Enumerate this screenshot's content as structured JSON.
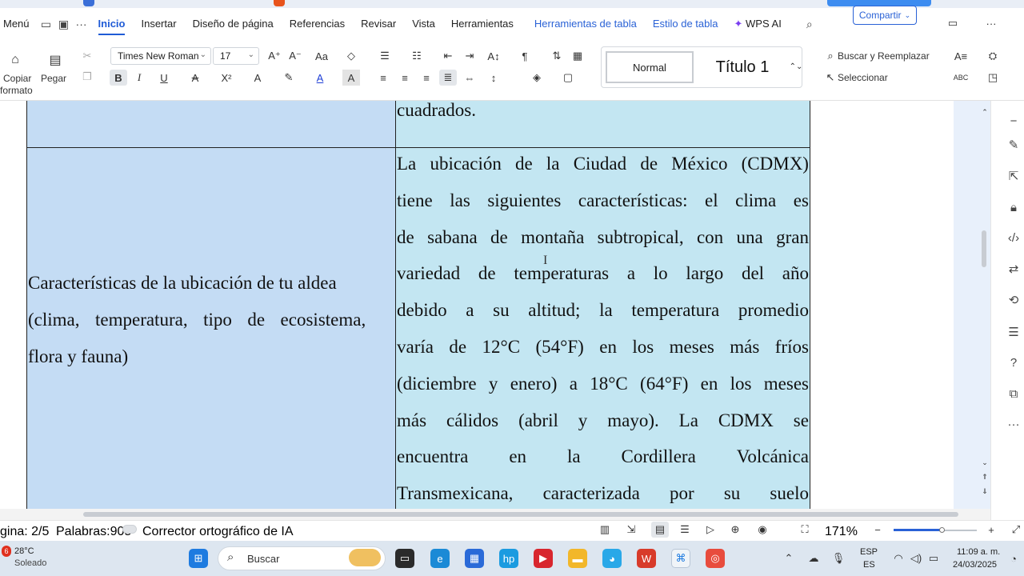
{
  "menubar": {
    "menu_label": "Menú",
    "tabs": [
      {
        "label": "Inicio",
        "active": true
      },
      {
        "label": "Insertar"
      },
      {
        "label": "Diseño de página"
      },
      {
        "label": "Referencias"
      },
      {
        "label": "Revisar"
      },
      {
        "label": "Vista"
      },
      {
        "label": "Herramientas"
      }
    ],
    "context_tabs": [
      "Herramientas de tabla",
      "Estilo de tabla"
    ],
    "wps_ai": "WPS AI",
    "share": "Compartir"
  },
  "ribbon": {
    "copy_format": "Copiar formato",
    "copy_label": "Copiar",
    "format_label": "formato",
    "paste": "Pegar",
    "font_name": "Times New Roman",
    "font_size": "17",
    "styles": {
      "normal": "Normal",
      "title1": "Título 1"
    },
    "find_replace": "Buscar y Reemplazar",
    "select": "Seleccionar"
  },
  "document": {
    "top_right_fragment": "cuadrados.",
    "row_label": "Características de la ubicación de tu aldea (clima, temperatura, tipo de ecosistema, flora y fauna)",
    "row_label_lines": [
      "Características de la ubicación de tu aldea",
      "(clima,  temperatura,  tipo  de  ecosistema,",
      "flora y fauna)"
    ],
    "row_content_lines": [
      "La ubicación de la Ciudad de México (CDMX)",
      "tiene las siguientes características: el clima es",
      "de sabana de montaña subtropical, con una gran",
      "variedad de temperaturas a lo largo del año",
      "debido a su altitud; la temperatura promedio",
      "varía de 12°C (54°F) en los meses más fríos",
      "(diciembre y enero) a 18°C (64°F) en los meses",
      "más cálidos (abril y mayo). La CDMX se",
      "encuentra en la Cordillera Volcánica",
      "Transmexicana, caracterizada por su suelo"
    ],
    "colors": {
      "left_cell": "#c4dcf4",
      "right_cell": "#c3e6f2"
    }
  },
  "statusbar": {
    "page": "gina: 2/5",
    "words": "Palabras:905",
    "spellcheck": "Corrector ortográfico de IA",
    "zoom": "171%"
  },
  "taskbar": {
    "weather_temp": "28°C",
    "weather_desc": "Soleado",
    "weather_badge": "6",
    "search_placeholder": "Buscar",
    "lang_top": "ESP",
    "lang_bottom": "ES",
    "time": "11:09 a. m.",
    "date": "24/03/2025"
  }
}
